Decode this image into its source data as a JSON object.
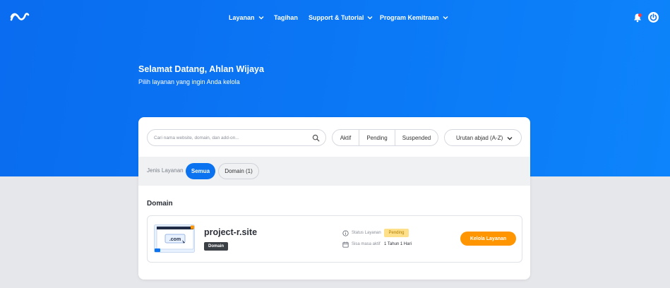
{
  "brand": {
    "logo_icon": "wave-logo-icon"
  },
  "nav": {
    "items": [
      {
        "label": "Layanan",
        "has_dropdown": true
      },
      {
        "label": "Tagihan",
        "has_dropdown": false
      },
      {
        "label": "Support & Tutorial",
        "has_dropdown": true
      },
      {
        "label": "Program Kemitraan",
        "has_dropdown": true
      }
    ],
    "notification_icon": "bell-icon",
    "power_icon": "power-icon"
  },
  "welcome": {
    "title": "Selamat Datang, Ahlan Wijaya",
    "subtitle": "Pilih layanan yang ingin Anda kelola"
  },
  "toolbar": {
    "search_placeholder": "Cari nama website, domain, dan add-on...",
    "search_value": "",
    "status_filters": [
      "Aktif",
      "Pending",
      "Suspended"
    ],
    "sort_label": "Urutan abjad (A-Z)"
  },
  "filters": {
    "label": "Jenis Layanan",
    "chips": [
      {
        "label": "Semua",
        "active": true
      },
      {
        "label": "Domain (1)",
        "active": false
      }
    ]
  },
  "sections": [
    {
      "title": "Domain",
      "items": [
        {
          "thumbnail_text": ".com",
          "name": "project-r.site",
          "type_badge": "Domain",
          "status_label": "Status Layanan",
          "status_value": "Pending",
          "remaining_label": "Sisa masa aktif",
          "remaining_value": "1 Tahun 1 Hari",
          "action_label": "Kelola Layanan"
        }
      ]
    }
  ],
  "colors": {
    "hero_blue": "#0b78f5",
    "active_chip": "#0b72f0",
    "action_orange": "#ff9500",
    "pending_bg": "#ffe08a",
    "page_bg": "#e6e7ea"
  }
}
